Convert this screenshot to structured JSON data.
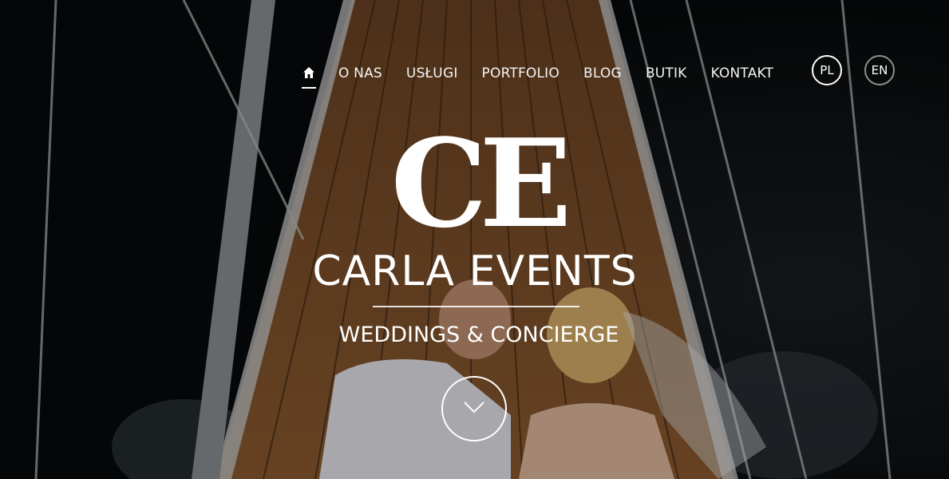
{
  "nav": {
    "home_icon": "home-icon",
    "items": [
      {
        "label": "O NAS"
      },
      {
        "label": "USŁUGI"
      },
      {
        "label": "PORTFOLIO"
      },
      {
        "label": "BLOG"
      },
      {
        "label": "BUTIK"
      },
      {
        "label": "KONTAKT"
      }
    ],
    "languages": [
      {
        "label": "PL",
        "active": true
      },
      {
        "label": "EN",
        "active": false
      }
    ]
  },
  "hero": {
    "monogram": "CE",
    "brand_name": "CARLA EVENTS",
    "tagline": "WEDDINGS & CONCIERGE",
    "scroll_icon": "chevron-down-icon"
  },
  "colors": {
    "text": "#ffffff",
    "background": "#0d0e10",
    "deck_wood": "#8a5a2e"
  }
}
